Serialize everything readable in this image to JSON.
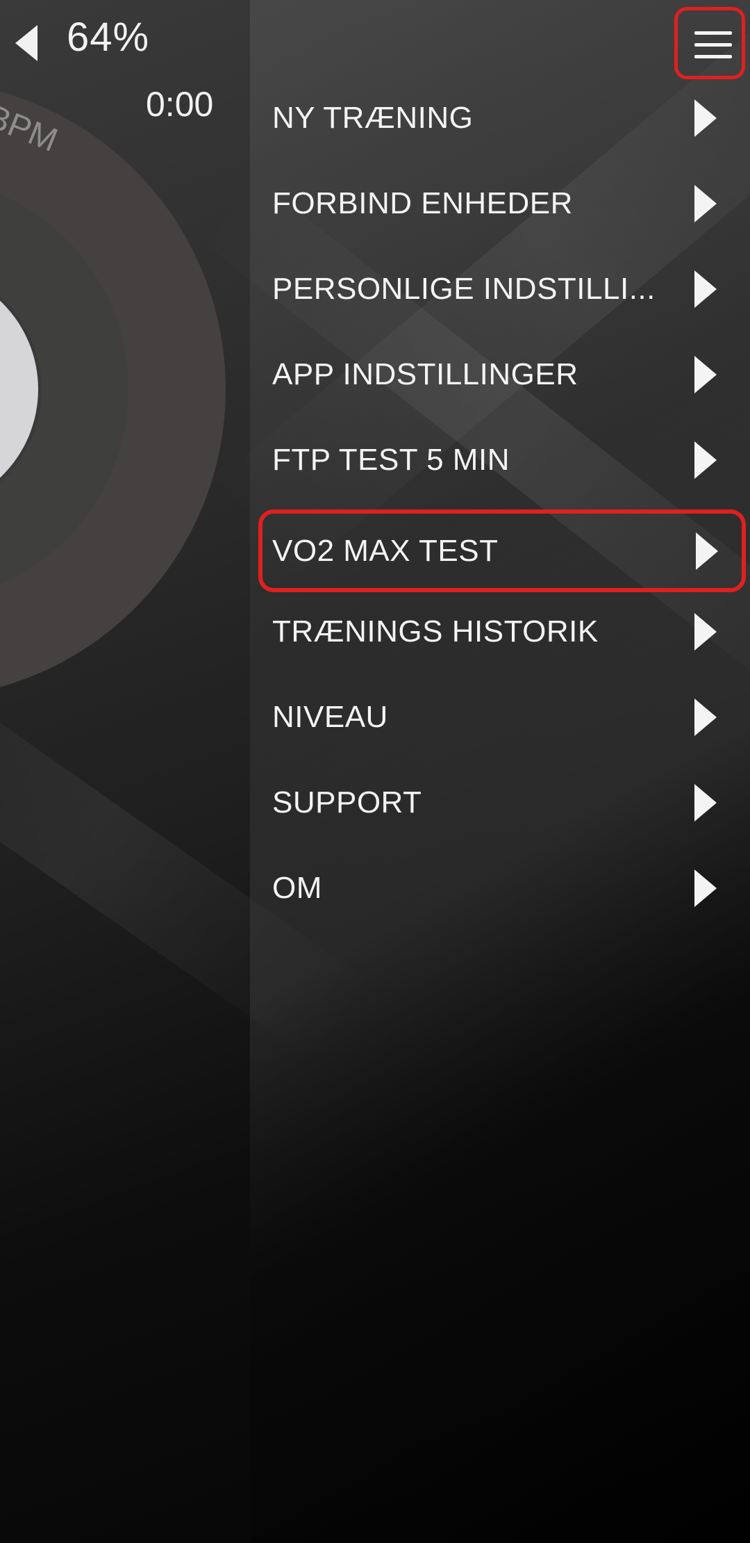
{
  "status": {
    "battery_percent": "64%",
    "timer": "0:00",
    "heart_rate_unit": "BPM"
  },
  "icons": {
    "back": "back-arrow-icon",
    "menu": "hamburger-menu-icon",
    "chevron": "chevron-right-icon"
  },
  "colors": {
    "highlight": "#e0201f",
    "text": "#f4f4f4"
  },
  "menu": {
    "items": [
      {
        "label": "NY TRÆNING"
      },
      {
        "label": "FORBIND ENHEDER"
      },
      {
        "label": "PERSONLIGE INDSTILLI..."
      },
      {
        "label": "APP INDSTILLINGER"
      },
      {
        "label": "FTP TEST 5 MIN"
      },
      {
        "label": "VO2 MAX TEST"
      },
      {
        "label": "TRÆNINGS HISTORIK"
      },
      {
        "label": "NIVEAU"
      },
      {
        "label": "SUPPORT"
      },
      {
        "label": "OM"
      }
    ]
  }
}
